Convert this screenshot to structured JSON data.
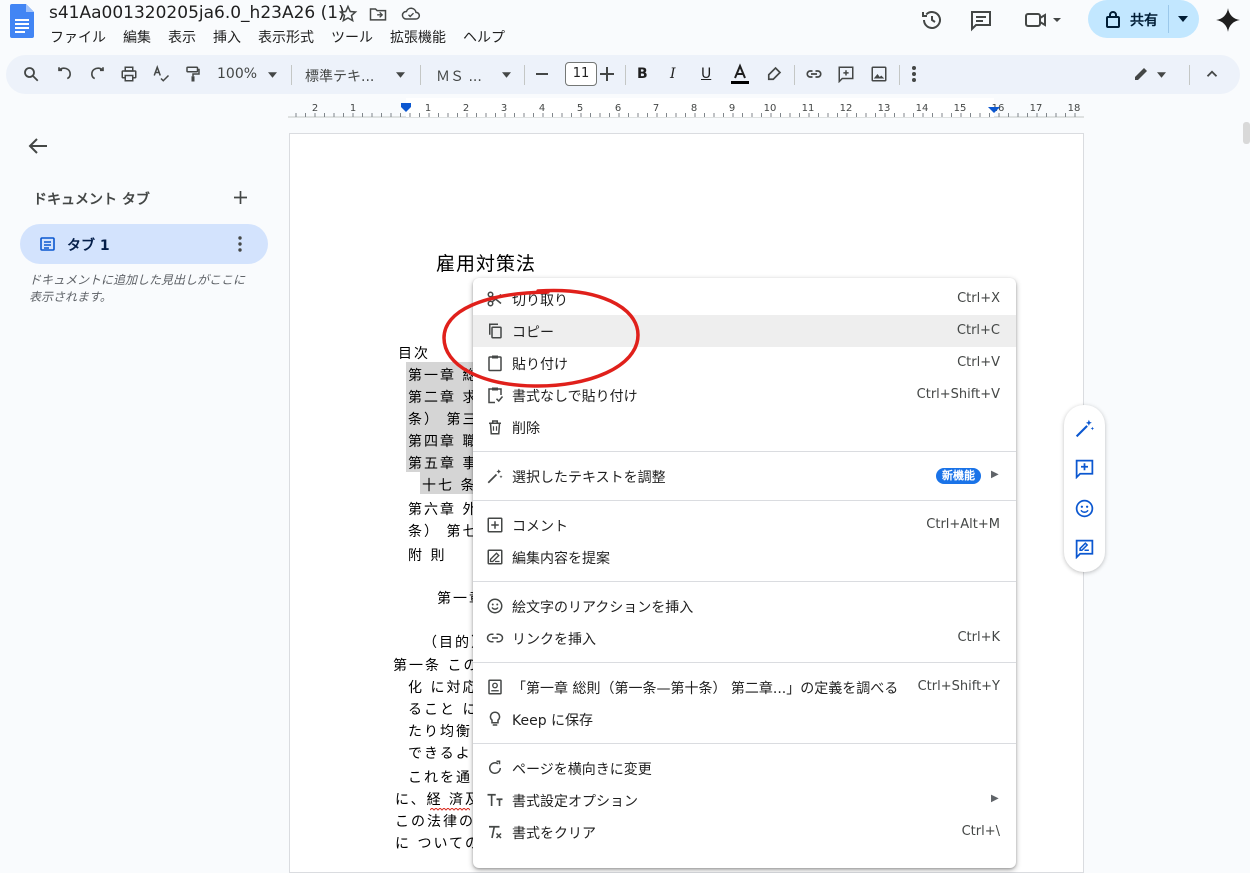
{
  "header": {
    "doc_title": "s41Aa001320205ja6.0_h23A26 (1)",
    "share_label": "共有",
    "menu": [
      "ファイル",
      "編集",
      "表示",
      "挿入",
      "表示形式",
      "ツール",
      "拡張機能",
      "ヘルプ"
    ]
  },
  "toolbar": {
    "zoom": "100%",
    "style": "標準テキ...",
    "font": "ＭＳ ...",
    "font_size": "11"
  },
  "ruler": {
    "labels": [
      "2",
      "1",
      "1",
      "2",
      "3",
      "4",
      "5",
      "6",
      "7",
      "8",
      "9",
      "10",
      "11",
      "12",
      "13",
      "14",
      "15",
      "16",
      "17",
      "18"
    ]
  },
  "sidebar": {
    "heading": "ドキュメント タブ",
    "tab_label": "タブ 1",
    "hint": "ドキュメントに追加した見出しがここに表示されます。"
  },
  "document": {
    "title": "雇用対策法",
    "toc_heading": "目次",
    "toc_lines": [
      "第一章 総",
      "第二章 求",
      "条） 第三",
      "第四章 職",
      "第五章 事",
      "十七 条",
      "第六章 外",
      "条） 第七",
      "附 則"
    ],
    "chapter1": "第一章",
    "purpose": "（目的）",
    "body_lines": [
      "第一条 この",
      "化 に対応",
      "ること に",
      "たり均衡",
      "できるよ",
      "これを通",
      "に、経 済及",
      "この法律の",
      "に ついての"
    ]
  },
  "context_menu": {
    "items": [
      {
        "label": "切り取り",
        "shortcut": "Ctrl+X",
        "icon": "scissors-icon"
      },
      {
        "label": "コピー",
        "shortcut": "Ctrl+C",
        "icon": "copy-icon"
      },
      {
        "label": "貼り付け",
        "shortcut": "Ctrl+V",
        "icon": "paste-icon"
      },
      {
        "label": "書式なしで貼り付け",
        "shortcut": "Ctrl+Shift+V",
        "icon": "paste-plain-icon"
      },
      {
        "label": "削除",
        "shortcut": "",
        "icon": "trash-icon"
      },
      {
        "label": "選択したテキストを調整",
        "shortcut": "",
        "icon": "magic-pen-icon",
        "badge": "新機能"
      },
      {
        "label": "コメント",
        "shortcut": "Ctrl+Alt+M",
        "icon": "comment-add-icon"
      },
      {
        "label": "編集内容を提案",
        "shortcut": "",
        "icon": "suggest-edit-icon"
      },
      {
        "label": "絵文字のリアクションを挿入",
        "shortcut": "",
        "icon": "emoji-icon"
      },
      {
        "label": "リンクを挿入",
        "shortcut": "Ctrl+K",
        "icon": "link-icon"
      },
      {
        "label": "「第一章 総則（第一条—第十条） 第二章...」の定義を調べる",
        "shortcut": "Ctrl+Shift+Y",
        "icon": "dictionary-icon"
      },
      {
        "label": "Keep に保存",
        "shortcut": "",
        "icon": "keep-bulb-icon"
      },
      {
        "label": "ページを横向きに変更",
        "shortcut": "",
        "icon": "rotate-icon"
      },
      {
        "label": "書式設定オプション",
        "shortcut": "",
        "icon": "text-format-icon"
      },
      {
        "label": "書式をクリア",
        "shortcut": "Ctrl+\\",
        "icon": "clear-format-icon"
      }
    ]
  },
  "colors": {
    "accent": "#0b57d0",
    "share_bg": "#c2e7ff",
    "tab_bg": "#d3e3fd",
    "annotation_red": "#e0201b",
    "badge": "#1a73e8"
  }
}
